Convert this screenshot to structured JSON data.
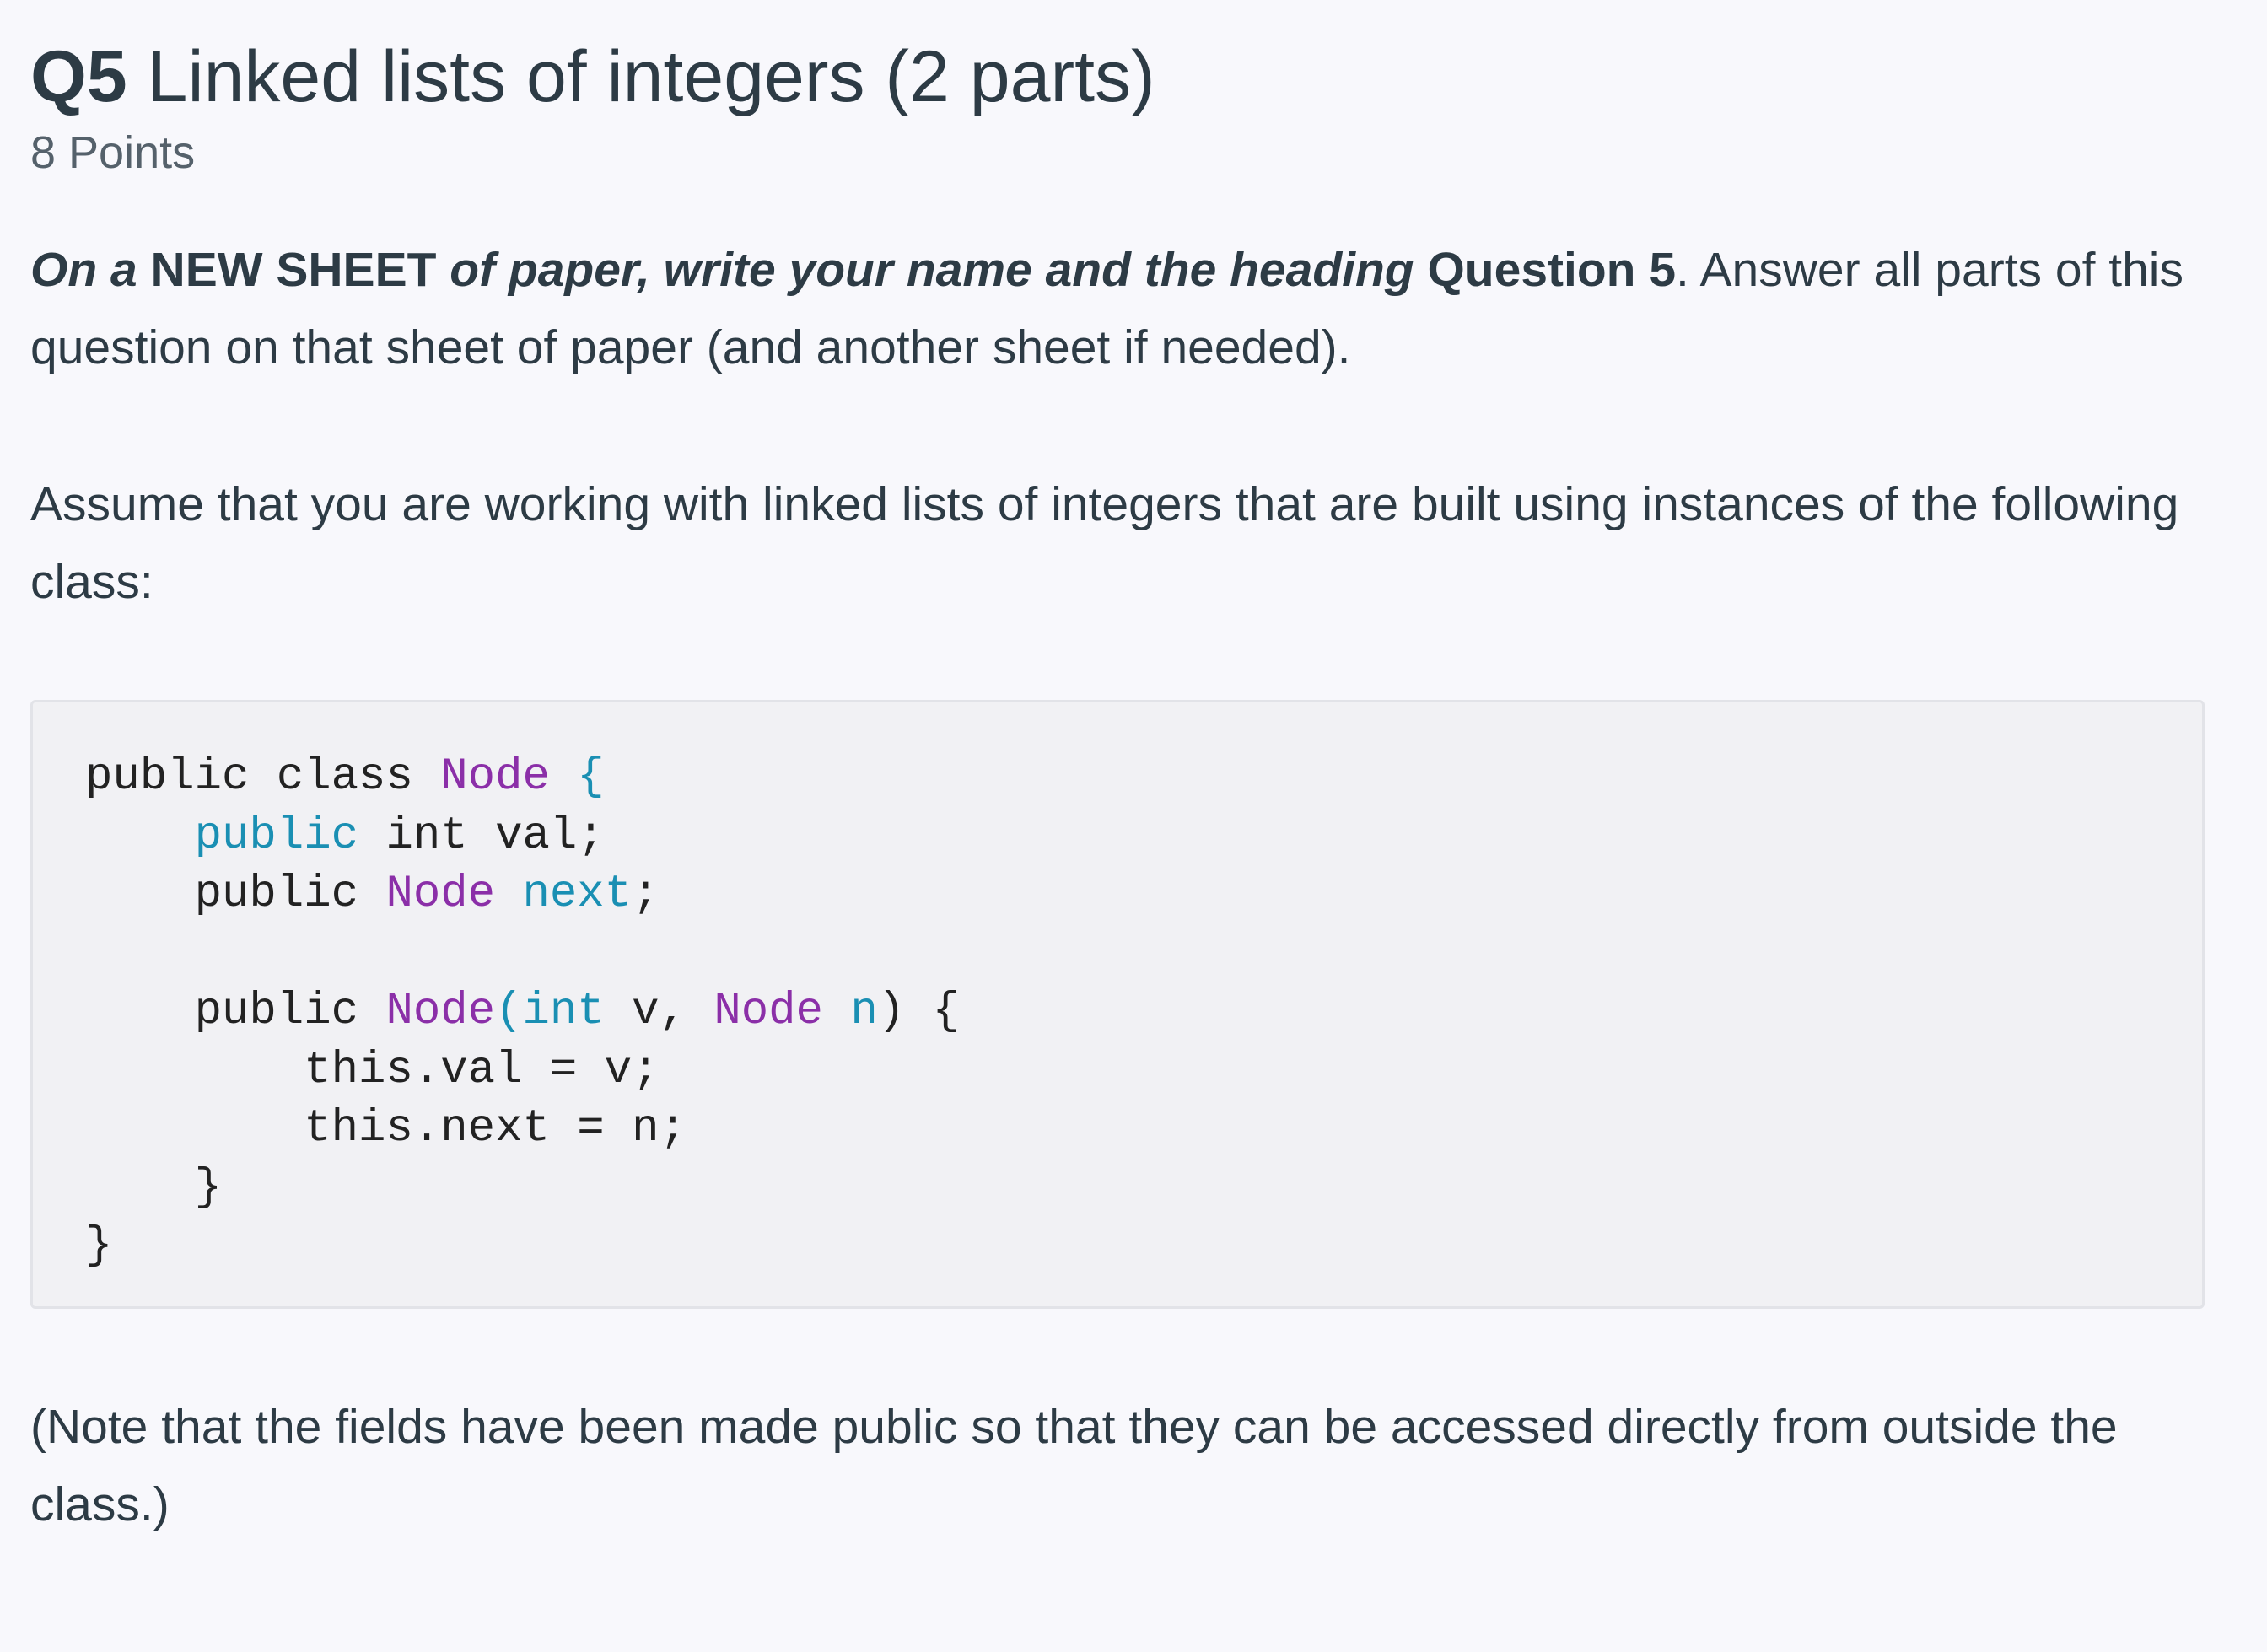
{
  "question": {
    "number": "Q5",
    "title": "Linked lists of integers (2 parts)",
    "points": "8 Points"
  },
  "instructions": {
    "part1": "On a",
    "part2": "NEW SHEET",
    "part3": "of paper, write your name and the heading",
    "part4": "Question 5",
    "part5": ". Answer all parts of this question on that sheet of paper (and another sheet if needed)."
  },
  "intro": "Assume that you are working with linked lists of integers that are built using instances of the following class:",
  "code": {
    "l1_a": "public class ",
    "l1_b": "Node",
    "l1_c": " {",
    "l2_a": "    ",
    "l2_b": "public",
    "l2_c": " int val;",
    "l3_a": "    public ",
    "l3_b": "Node",
    "l3_c": " ",
    "l3_d": "next",
    "l3_e": ";",
    "l4": "",
    "l5_a": "    public ",
    "l5_b": "Node",
    "l5_c": "(int",
    "l5_d": " v, ",
    "l5_e": "Node",
    "l5_f": " n",
    "l5_g": ") {",
    "l6": "        this.val = v;",
    "l7": "        this.next = n;",
    "l8": "    }",
    "l9": "}"
  },
  "note": "(Note that the fields have been made public so that they can be accessed directly from outside the class.)",
  "colors": {
    "keyword": "#1a8fb3",
    "type": "#8b2fa8",
    "text": "#2d3b45",
    "background": "#f8f8fc",
    "code_background": "#f1f1f4"
  }
}
